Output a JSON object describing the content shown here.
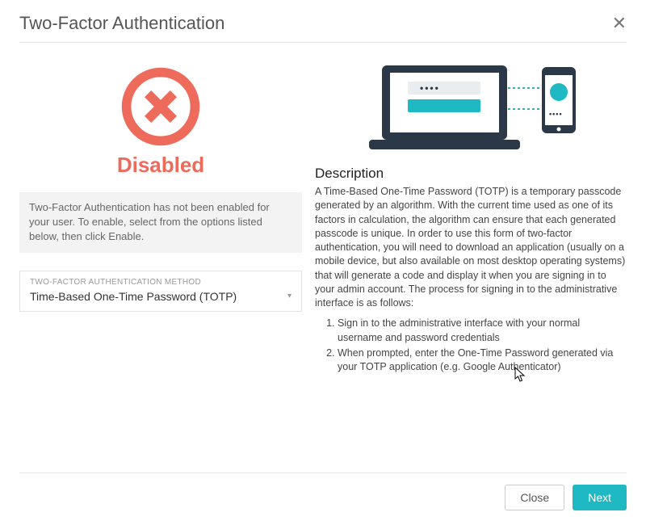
{
  "dialog": {
    "title": "Two-Factor Authentication"
  },
  "status": {
    "label": "Disabled",
    "note": "Two-Factor Authentication has not been enabled for your user. To enable, select from the options listed below, then click Enable."
  },
  "method": {
    "label": "TWO-FACTOR AUTHENTICATION METHOD",
    "value": "Time-Based One-Time Password (TOTP)"
  },
  "description": {
    "heading": "Description",
    "text": "A Time-Based One-Time Password (TOTP) is a temporary passcode generated by an algorithm. With the current time used as one of its factors in calculation, the algorithm can ensure that each generated passcode is unique. In order to use this form of two-factor authentication, you will need to download an application (usually on a mobile device, but also available on most desktop operating systems) that will generate a code and display it when you are signing in to your admin account. The process for signing in to the administrative interface is as follows:",
    "steps": [
      "Sign in to the administrative interface with your normal username and password credentials",
      "When prompted, enter the One-Time Password generated via your TOTP application (e.g. Google Authenticator)"
    ]
  },
  "footer": {
    "close_label": "Close",
    "next_label": "Next"
  }
}
